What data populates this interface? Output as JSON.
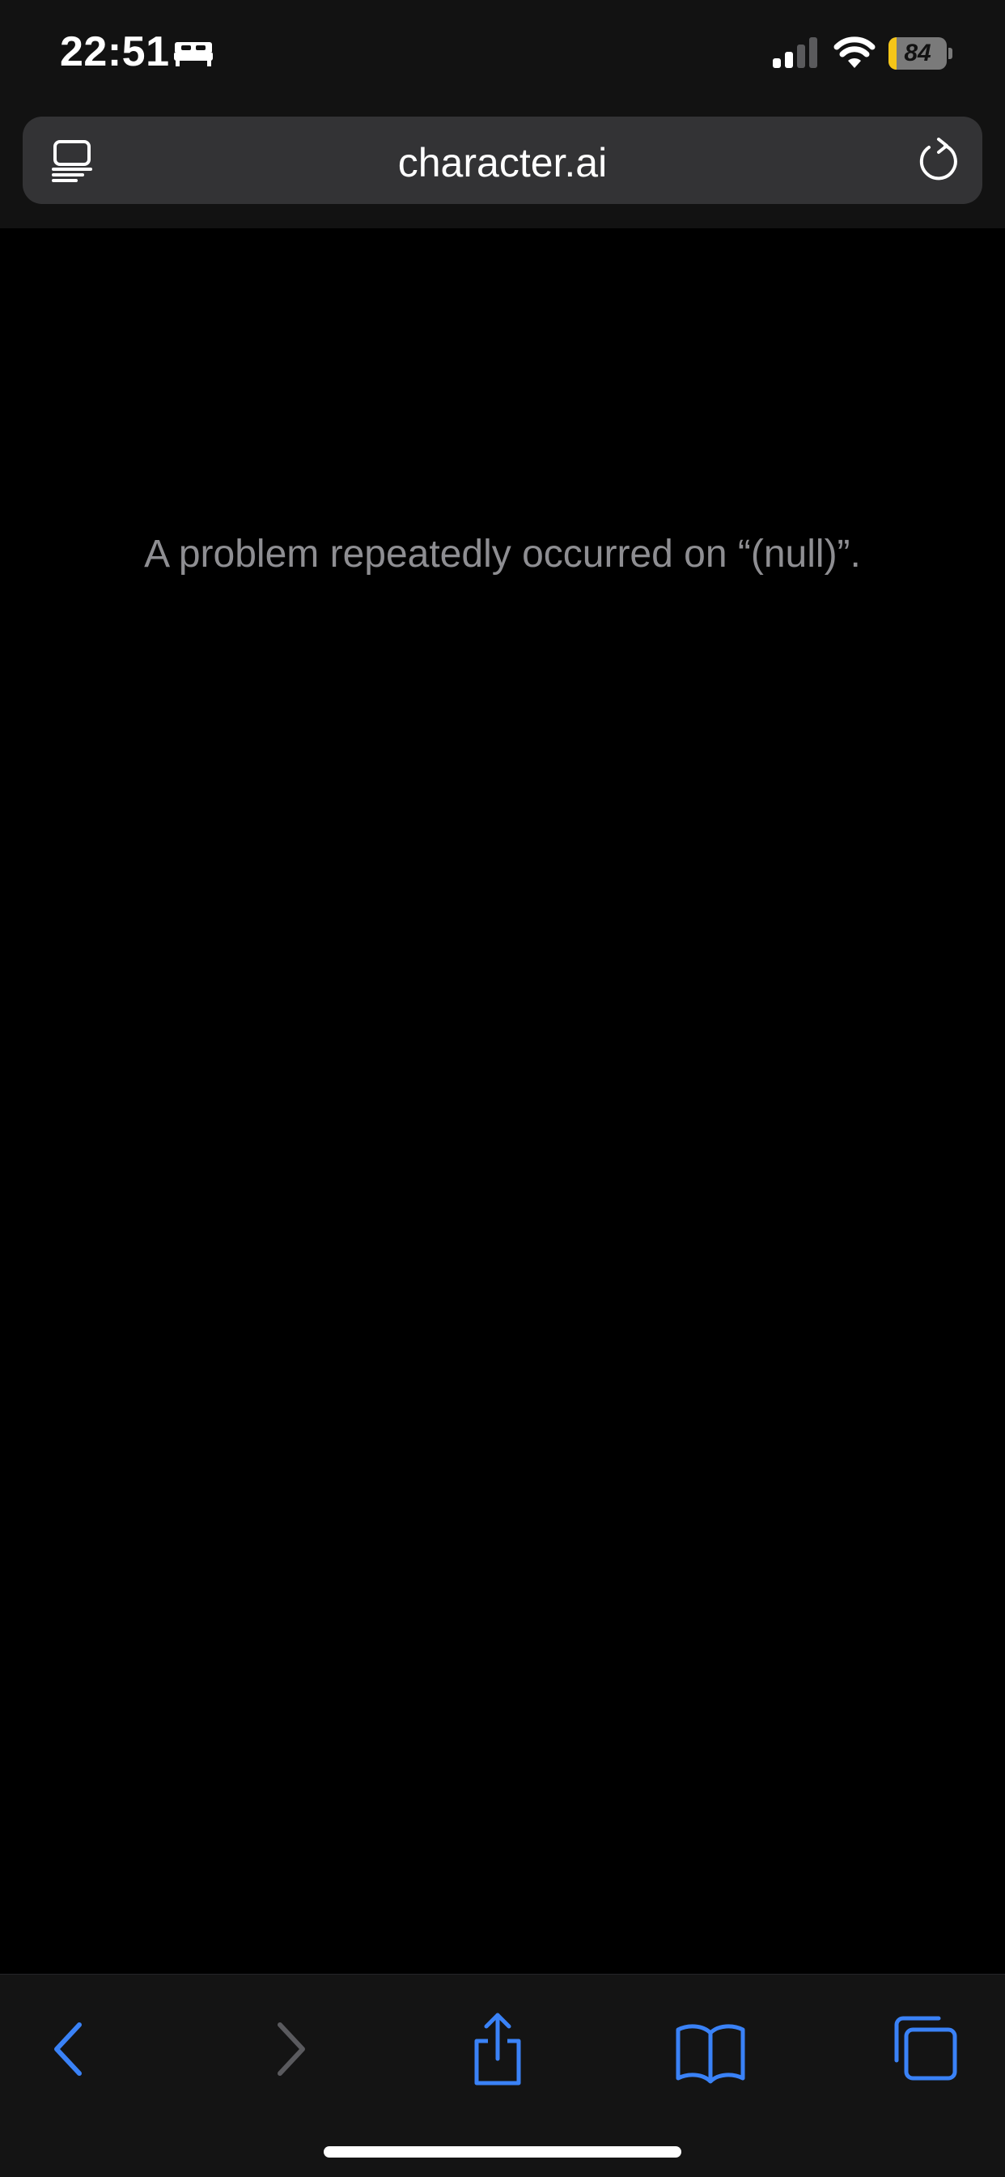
{
  "status_bar": {
    "time": "22:51",
    "battery_level": "84"
  },
  "address_bar": {
    "url": "character.ai"
  },
  "page": {
    "error_message": "A problem repeatedly occurred on “(null)”."
  },
  "colors": {
    "accent": "#3a82f7",
    "disabled": "#5a5a5e",
    "message_text": "#8e8e92",
    "chrome_background": "#121212",
    "content_background": "#000000"
  },
  "icons": {
    "sleep": "bed-icon",
    "signal": "cellular-signal-icon",
    "wifi": "wifi-icon",
    "battery": "battery-charging-icon",
    "reader": "page-menu-icon",
    "reload": "reload-icon",
    "back": "chevron-left-icon",
    "forward": "chevron-right-icon",
    "share": "share-icon",
    "bookmarks": "book-icon",
    "tabs": "tabs-icon"
  }
}
